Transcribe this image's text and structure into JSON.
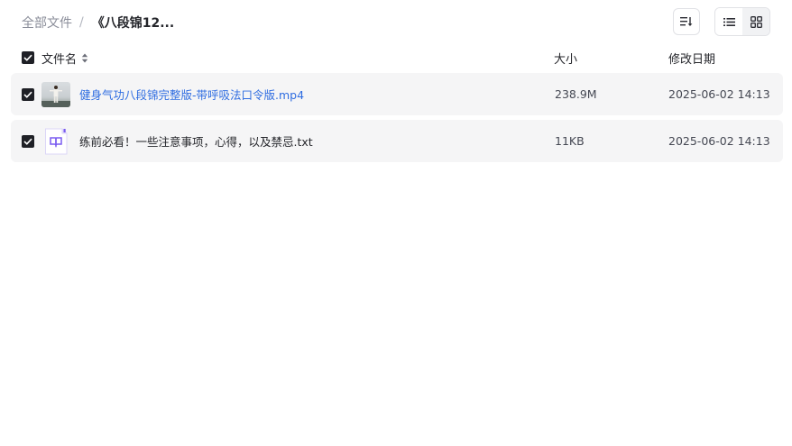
{
  "breadcrumb": {
    "root": "全部文件",
    "separator": "/",
    "current": "《八段锦12..."
  },
  "toolbar": {
    "sort_icon": "sort-list-icon",
    "list_view_icon": "list-view-icon",
    "grid_view_icon": "grid-view-icon"
  },
  "columns": {
    "name": "文件名",
    "size": "大小",
    "modified": "修改日期"
  },
  "files": [
    {
      "name": "健身气功八段锦完整版-带呼吸法口令版.mp4",
      "size": "238.9M",
      "modified": "2025-06-02 14:13",
      "type": "video",
      "checked": true
    },
    {
      "name": "练前必看！一些注意事项，心得，以及禁忌.txt",
      "size": "11KB",
      "modified": "2025-06-02 14:13",
      "type": "text",
      "checked": true
    }
  ],
  "colors": {
    "link": "#2f6de1",
    "row_bg": "#f5f5f6",
    "checkbox": "#1f2026",
    "txt_icon_accent": "#7a5cf0"
  }
}
